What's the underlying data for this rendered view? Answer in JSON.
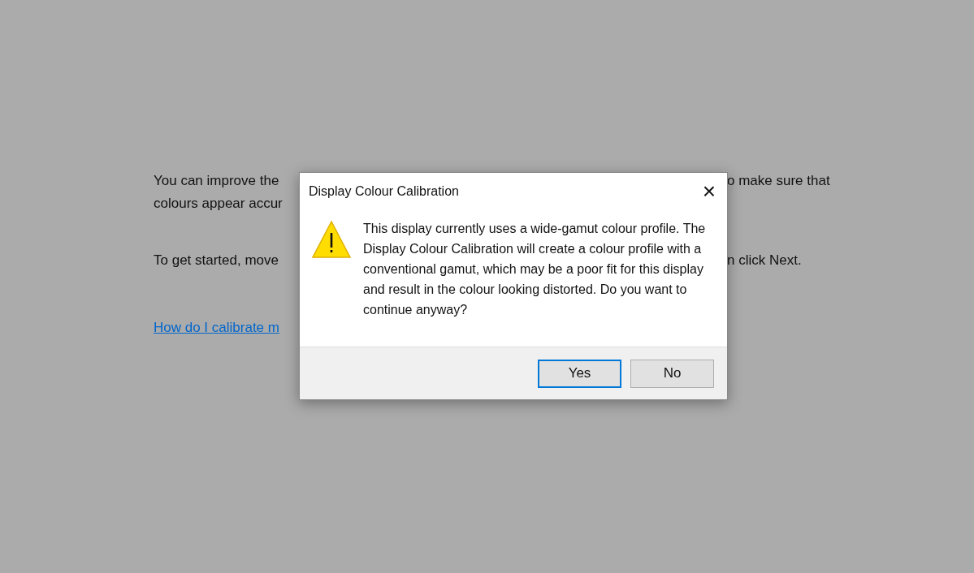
{
  "background": {
    "lines": [
      {
        "left": "You can improve the",
        "right": "o make sure that"
      },
      {
        "left": "colours appear accur"
      },
      {
        "left": "To get started, move",
        "right": "n click Next."
      }
    ],
    "link": "How do I calibrate m"
  },
  "dialog": {
    "title": "Display Colour Calibration",
    "close": "×",
    "message": "This display currently uses a wide-gamut colour profile.  The Display Colour Calibration will create a colour profile with a conventional gamut, which may be a poor fit for this display and result in the colour looking distorted.  Do you want to continue anyway?",
    "buttons": [
      {
        "label": "Yes",
        "selected": true
      },
      {
        "label": "No",
        "selected": false
      }
    ]
  }
}
